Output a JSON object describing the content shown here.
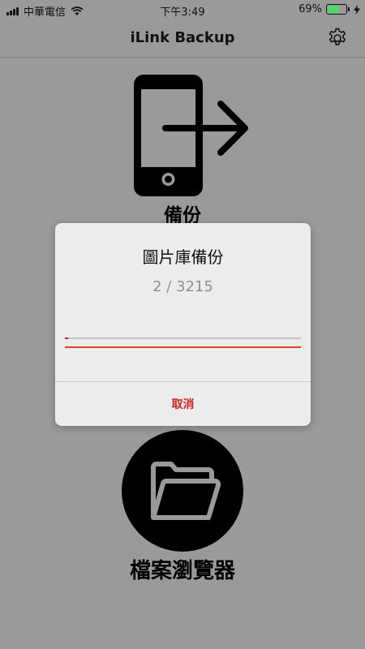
{
  "status_bar": {
    "carrier": "中華電信",
    "time": "下午3:49",
    "battery_percent_text": "69%",
    "battery_level": 0.69
  },
  "nav": {
    "title": "iLink Backup",
    "settings_icon": "gear-icon"
  },
  "main": {
    "backup": {
      "label": "備份",
      "icon": "phone-export-icon"
    },
    "files": {
      "label": "檔案瀏覽器",
      "icon": "folder-icon"
    }
  },
  "dialog": {
    "title": "圖片庫備份",
    "progress_text": "2 / 3215",
    "progress_value": 0.0006,
    "cancel_label": "取消"
  },
  "colors": {
    "accent_red": "#d81e1e",
    "battery_green": "#4cd964"
  }
}
